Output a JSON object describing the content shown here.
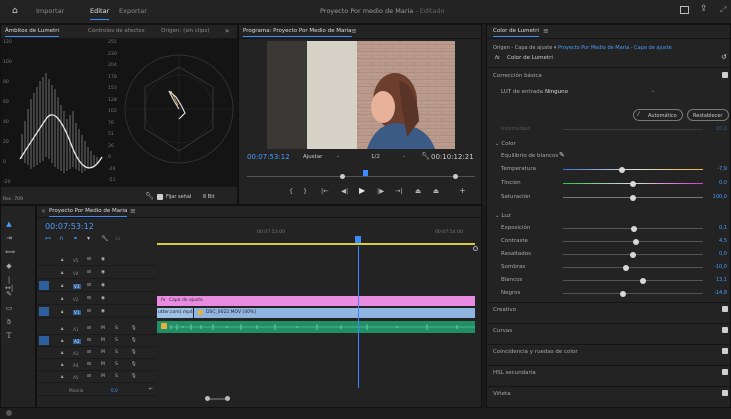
{
  "app": {
    "window_title": "Proyecto Por medio de Maria",
    "window_subtitle": "- Editado",
    "nav": {
      "import": "Importar",
      "edit": "Editar",
      "export": "Exportar"
    }
  },
  "scopes": {
    "tabs": {
      "lumetri": "Ámbitos de Lumetri",
      "effects": "Controles de efectos",
      "source": "Origen: (sin clips)"
    },
    "left_scale": [
      "120",
      "100",
      "80",
      "60",
      "40",
      "20",
      "0",
      "-20"
    ],
    "rgb_scale": [
      "255",
      "230",
      "204",
      "178",
      "153",
      "128",
      "102",
      "76",
      "51",
      "26",
      "0",
      "-26",
      "-51"
    ],
    "footer_left": "Rec. 709",
    "footer_checkbox": "Fijar señal",
    "footer_bits": "8 Bit"
  },
  "program": {
    "title": "Programa: Proyecto Por Medio de Maria",
    "timecode": "00:07:53:12",
    "fit": "Ajustar",
    "quality": "1/2",
    "duration": "00:10:12:21"
  },
  "timeline": {
    "sequence_name": "Proyecto Por Medio de Maria",
    "timecode": "00:07:53:12",
    "ruler": [
      "00:07:53:00",
      "00:07:54:00"
    ],
    "video_tracks": [
      "V5",
      "V4",
      "V3",
      "V2",
      "V1"
    ],
    "audio_tracks": [
      "A1",
      "A2",
      "A3",
      "A4",
      "A5"
    ],
    "mix_label": "Mezcla",
    "mix_value": "0,0",
    "clip_adjust": "Capa de ajuste",
    "clip_v1a": "utter.com).mp4",
    "clip_v1b": "DSC_0022.MOV [40%]",
    "clip_fx": "fx"
  },
  "lumetri": {
    "title": "Color de Lumetri",
    "source": "Origen - Capa de ajuste",
    "target": "Proyecto Por Medio de Maria - Capa de ajuste",
    "fx_item": "Color de Lumetri",
    "basic": "Corrección básica",
    "lut_label": "LUT de entrada",
    "lut_value": "Ninguno",
    "auto": "Automático",
    "reset": "Restablecer",
    "intensity": "Intensidad",
    "intensity_val": "10,0",
    "color": "Color",
    "wb": "Equilibrio de blancos",
    "temp": "Temperatura",
    "temp_val": "-7,9",
    "temp_level": 0.42,
    "tint": "Tinción",
    "tint_val": "0,0",
    "tint_level": 0.5,
    "sat": "Saturación",
    "sat_val": "100,0",
    "sat_level": 0.5,
    "light": "Luz",
    "exposure": "Exposición",
    "exposure_val": "0,1",
    "exposure_level": 0.51,
    "contrast": "Contraste",
    "contrast_val": "4,5",
    "contrast_level": 0.52,
    "highlights": "Resaltados",
    "highlights_val": "0,0",
    "highlights_level": 0.5,
    "shadows": "Sombras",
    "shadows_val": "-10,0",
    "shadows_level": 0.45,
    "whites": "Blancos",
    "whites_val": "13,1",
    "whites_level": 0.57,
    "blacks": "Negros",
    "blacks_val": "-14,8",
    "blacks_level": 0.43,
    "creative": "Creativo",
    "curves": "Curvas",
    "wheels": "Coincidencia y ruedas de color",
    "hsl": "HSL secundaria",
    "vignette": "Viñeta"
  },
  "colors": {
    "accent": "#3b8bff",
    "clip_adjust": "#e98be0",
    "clip_video": "#8fb5e0",
    "clip_audio": "#2aa77c",
    "value": "#4a9cff"
  }
}
